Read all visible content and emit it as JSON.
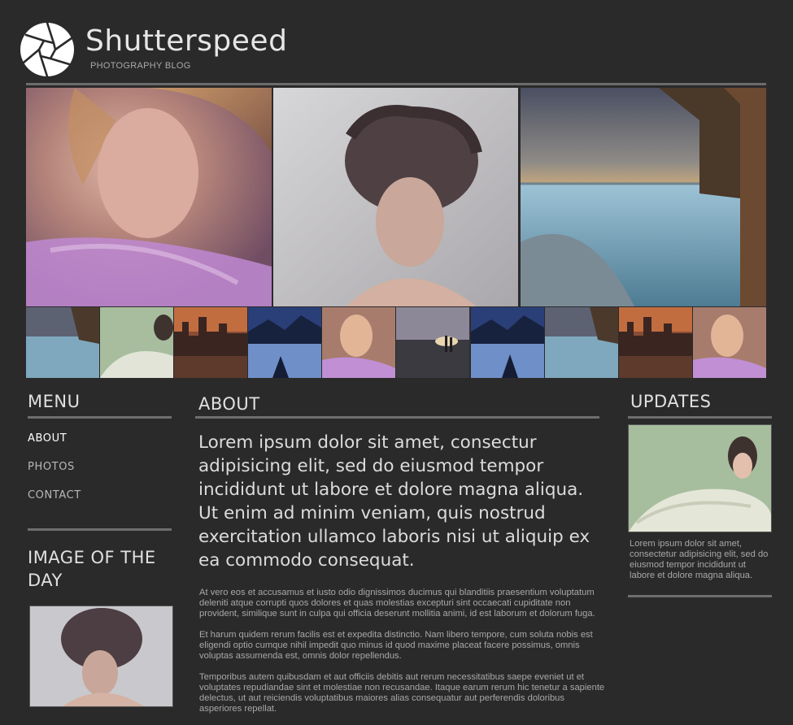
{
  "header": {
    "site_title": "Shutterspeed",
    "tagline": "PHOTOGRAPHY BLOG",
    "logo_icon": "aperture-icon"
  },
  "menu": {
    "title": "MENU",
    "items": [
      {
        "label": "ABOUT",
        "active": true
      },
      {
        "label": "PHOTOS",
        "active": false
      },
      {
        "label": "CONTACT",
        "active": false
      }
    ]
  },
  "image_of_day": {
    "title": "IMAGE OF THE DAY"
  },
  "about": {
    "title": "ABOUT",
    "lead": "Lorem ipsum dolor sit amet, consectur adipisicing elit, sed do eiusmod tempor incididunt ut labore et dolore magna aliqua. Ut enim ad minim veniam, quis nostrud exercitation ullamco laboris nisi ut aliquip ex ea commodo consequat.",
    "paragraphs": [
      "At vero eos et accusamus et iusto odio dignissimos ducimus qui blanditiis praesentium voluptatum deleniti atque corrupti quos dolores et quas molestias excepturi sint occaecati cupiditate non provident, similique sunt in culpa qui officia deserunt mollitia animi, id est laborum et dolorum fuga.",
      "Et harum quidem rerum facilis est et expedita distinctio. Nam libero tempore, cum soluta nobis est eligendi optio cumque nihil impedit quo minus id quod maxime placeat facere possimus, omnis voluptas assumenda est, omnis dolor repellendus.",
      "Temporibus autem quibusdam et aut officiis debitis aut rerum necessitatibus saepe eveniet ut et voluptates repudiandae sint et molestiae non recusandae. Itaque earum rerum hic tenetur a sapiente delectus, ut aut reiciendis voluptatibus maiores alias consequatur aut perferendis doloribus asperiores repellat."
    ]
  },
  "updates": {
    "title": "UPDATES",
    "text": "Lorem ipsum dolor sit amet, consectetur adipisicing elit, sed do eiusmod tempor incididunt ut labore et dolore magna aliqua."
  },
  "colors": {
    "background": "#2b2a2b",
    "rule": "#6e6e6e",
    "heading": "#e0e0e0",
    "body_text": "#a8a8a8"
  }
}
